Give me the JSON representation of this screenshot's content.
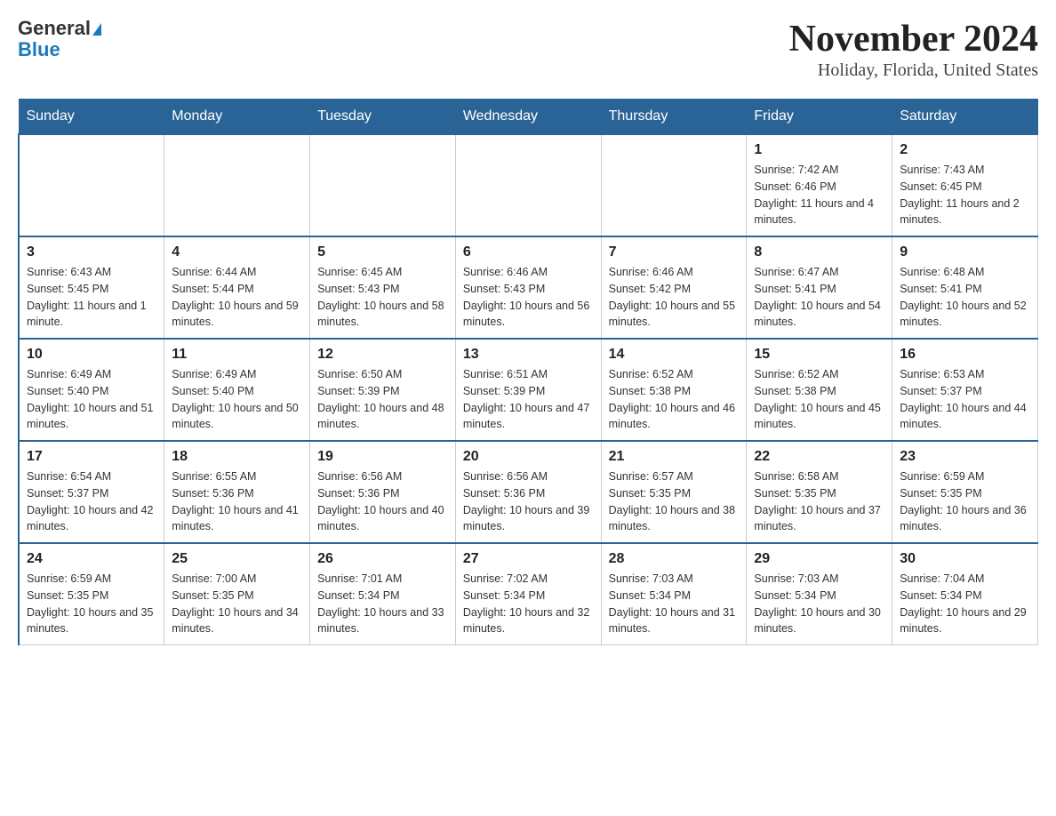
{
  "header": {
    "logo_general": "General",
    "logo_blue": "Blue",
    "title": "November 2024",
    "subtitle": "Holiday, Florida, United States"
  },
  "calendar": {
    "days_of_week": [
      "Sunday",
      "Monday",
      "Tuesday",
      "Wednesday",
      "Thursday",
      "Friday",
      "Saturday"
    ],
    "weeks": [
      [
        {
          "day": "",
          "info": ""
        },
        {
          "day": "",
          "info": ""
        },
        {
          "day": "",
          "info": ""
        },
        {
          "day": "",
          "info": ""
        },
        {
          "day": "",
          "info": ""
        },
        {
          "day": "1",
          "info": "Sunrise: 7:42 AM\nSunset: 6:46 PM\nDaylight: 11 hours and 4 minutes."
        },
        {
          "day": "2",
          "info": "Sunrise: 7:43 AM\nSunset: 6:45 PM\nDaylight: 11 hours and 2 minutes."
        }
      ],
      [
        {
          "day": "3",
          "info": "Sunrise: 6:43 AM\nSunset: 5:45 PM\nDaylight: 11 hours and 1 minute."
        },
        {
          "day": "4",
          "info": "Sunrise: 6:44 AM\nSunset: 5:44 PM\nDaylight: 10 hours and 59 minutes."
        },
        {
          "day": "5",
          "info": "Sunrise: 6:45 AM\nSunset: 5:43 PM\nDaylight: 10 hours and 58 minutes."
        },
        {
          "day": "6",
          "info": "Sunrise: 6:46 AM\nSunset: 5:43 PM\nDaylight: 10 hours and 56 minutes."
        },
        {
          "day": "7",
          "info": "Sunrise: 6:46 AM\nSunset: 5:42 PM\nDaylight: 10 hours and 55 minutes."
        },
        {
          "day": "8",
          "info": "Sunrise: 6:47 AM\nSunset: 5:41 PM\nDaylight: 10 hours and 54 minutes."
        },
        {
          "day": "9",
          "info": "Sunrise: 6:48 AM\nSunset: 5:41 PM\nDaylight: 10 hours and 52 minutes."
        }
      ],
      [
        {
          "day": "10",
          "info": "Sunrise: 6:49 AM\nSunset: 5:40 PM\nDaylight: 10 hours and 51 minutes."
        },
        {
          "day": "11",
          "info": "Sunrise: 6:49 AM\nSunset: 5:40 PM\nDaylight: 10 hours and 50 minutes."
        },
        {
          "day": "12",
          "info": "Sunrise: 6:50 AM\nSunset: 5:39 PM\nDaylight: 10 hours and 48 minutes."
        },
        {
          "day": "13",
          "info": "Sunrise: 6:51 AM\nSunset: 5:39 PM\nDaylight: 10 hours and 47 minutes."
        },
        {
          "day": "14",
          "info": "Sunrise: 6:52 AM\nSunset: 5:38 PM\nDaylight: 10 hours and 46 minutes."
        },
        {
          "day": "15",
          "info": "Sunrise: 6:52 AM\nSunset: 5:38 PM\nDaylight: 10 hours and 45 minutes."
        },
        {
          "day": "16",
          "info": "Sunrise: 6:53 AM\nSunset: 5:37 PM\nDaylight: 10 hours and 44 minutes."
        }
      ],
      [
        {
          "day": "17",
          "info": "Sunrise: 6:54 AM\nSunset: 5:37 PM\nDaylight: 10 hours and 42 minutes."
        },
        {
          "day": "18",
          "info": "Sunrise: 6:55 AM\nSunset: 5:36 PM\nDaylight: 10 hours and 41 minutes."
        },
        {
          "day": "19",
          "info": "Sunrise: 6:56 AM\nSunset: 5:36 PM\nDaylight: 10 hours and 40 minutes."
        },
        {
          "day": "20",
          "info": "Sunrise: 6:56 AM\nSunset: 5:36 PM\nDaylight: 10 hours and 39 minutes."
        },
        {
          "day": "21",
          "info": "Sunrise: 6:57 AM\nSunset: 5:35 PM\nDaylight: 10 hours and 38 minutes."
        },
        {
          "day": "22",
          "info": "Sunrise: 6:58 AM\nSunset: 5:35 PM\nDaylight: 10 hours and 37 minutes."
        },
        {
          "day": "23",
          "info": "Sunrise: 6:59 AM\nSunset: 5:35 PM\nDaylight: 10 hours and 36 minutes."
        }
      ],
      [
        {
          "day": "24",
          "info": "Sunrise: 6:59 AM\nSunset: 5:35 PM\nDaylight: 10 hours and 35 minutes."
        },
        {
          "day": "25",
          "info": "Sunrise: 7:00 AM\nSunset: 5:35 PM\nDaylight: 10 hours and 34 minutes."
        },
        {
          "day": "26",
          "info": "Sunrise: 7:01 AM\nSunset: 5:34 PM\nDaylight: 10 hours and 33 minutes."
        },
        {
          "day": "27",
          "info": "Sunrise: 7:02 AM\nSunset: 5:34 PM\nDaylight: 10 hours and 32 minutes."
        },
        {
          "day": "28",
          "info": "Sunrise: 7:03 AM\nSunset: 5:34 PM\nDaylight: 10 hours and 31 minutes."
        },
        {
          "day": "29",
          "info": "Sunrise: 7:03 AM\nSunset: 5:34 PM\nDaylight: 10 hours and 30 minutes."
        },
        {
          "day": "30",
          "info": "Sunrise: 7:04 AM\nSunset: 5:34 PM\nDaylight: 10 hours and 29 minutes."
        }
      ]
    ]
  }
}
